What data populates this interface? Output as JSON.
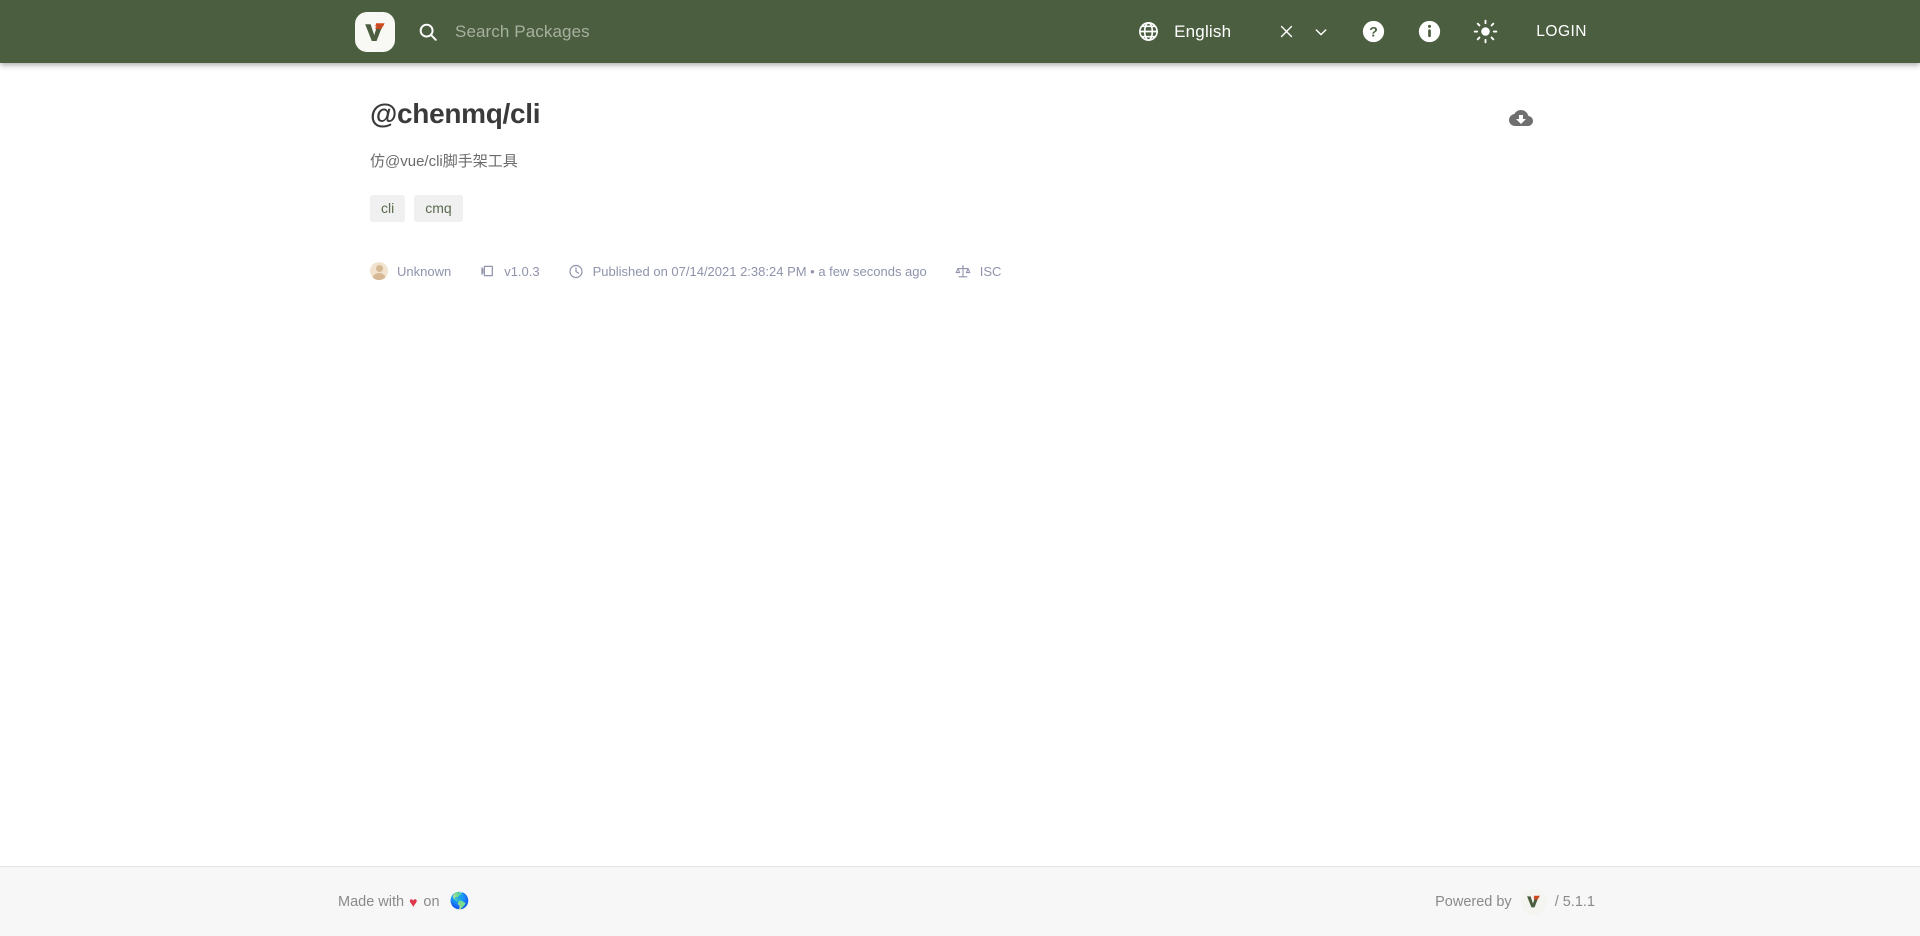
{
  "header": {
    "logo_icon": "verdaccio-logo-icon",
    "search": {
      "icon": "search-icon",
      "placeholder": "Search Packages",
      "value": ""
    },
    "language": {
      "icon": "globe-icon",
      "label": "English",
      "clear_icon": "close-icon",
      "chevron_icon": "chevron-down-icon"
    },
    "actions": [
      {
        "name": "help-icon",
        "title": "Help"
      },
      {
        "name": "info-icon",
        "title": "Information"
      },
      {
        "name": "brightness-icon",
        "title": "Toggle theme"
      }
    ],
    "login_label": "LOGIN"
  },
  "package": {
    "name": "@chenmq/cli",
    "description": "仿@vue/cli脚手架工具",
    "download_icon": "cloud-download-icon",
    "keywords": [
      "cli",
      "cmq"
    ],
    "meta": {
      "author_icon": "avatar-icon",
      "author": "Unknown",
      "version_icon": "package-icon",
      "version": "v1.0.3",
      "time_icon": "clock-icon",
      "published": "Published on 07/14/2021 2:38:24 PM • a few seconds ago",
      "license_icon": "scales-icon",
      "license": "ISC"
    }
  },
  "footer": {
    "made_with_prefix": "Made with",
    "heart": "♥",
    "made_with_suffix": "on",
    "earth": "🌎",
    "powered_by": "Powered by",
    "logo_icon": "verdaccio-logo-icon",
    "version": "/ 5.1.1"
  },
  "colors": {
    "header_bg": "#4b5e40",
    "accent_orange": "#cf4a1e",
    "logo_green": "#4b5e40",
    "meta_text": "#8f93ab",
    "tag_bg": "#f0f0f0",
    "footer_bg": "#f7f7f7",
    "heart_red": "#e0384a"
  }
}
